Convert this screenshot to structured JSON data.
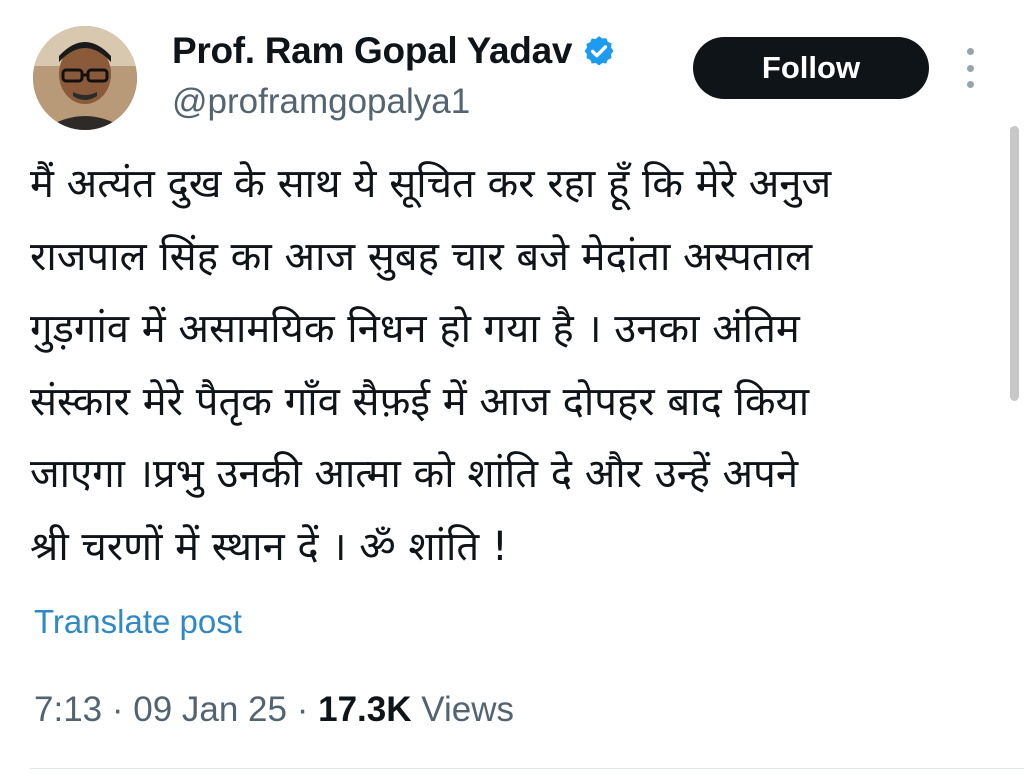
{
  "author": {
    "display_name": "Prof. Ram Gopal Yadav",
    "handle": "@proframgopalya1",
    "verified": true
  },
  "actions": {
    "follow_label": "Follow"
  },
  "post": {
    "lines": [
      "मैं अत्यंत दुख के साथ  ये सूचित कर रहा हूँ  कि मेरे अनुज",
      "राजपाल सिंह का  आज सुबह चार बजे मेदांता अस्पताल",
      "गुड़गांव  में असामयिक निधन हो गया है । उनका अंतिम",
      "संस्कार मेरे पैतृक गाँव सैफ़ई में आज दोपहर बाद किया",
      "जाएगा ।प्रभु उनकी आत्मा को शांति दे  और उन्हें अपने",
      "श्री चरणों में स्थान दें । ॐ शांति !"
    ],
    "translate_label": "Translate post"
  },
  "meta": {
    "time": "7:13",
    "separator": "·",
    "date": "09 Jan 25",
    "views_count": "17.3K",
    "views_label": "Views"
  },
  "colors": {
    "verified_badge": "#1d9bf0",
    "link": "#2f89c5",
    "follow_bg": "#0f1419",
    "muted_text": "#536471"
  },
  "icons": {
    "verified": "verified-badge-icon",
    "more": "more-vertical-icon"
  }
}
